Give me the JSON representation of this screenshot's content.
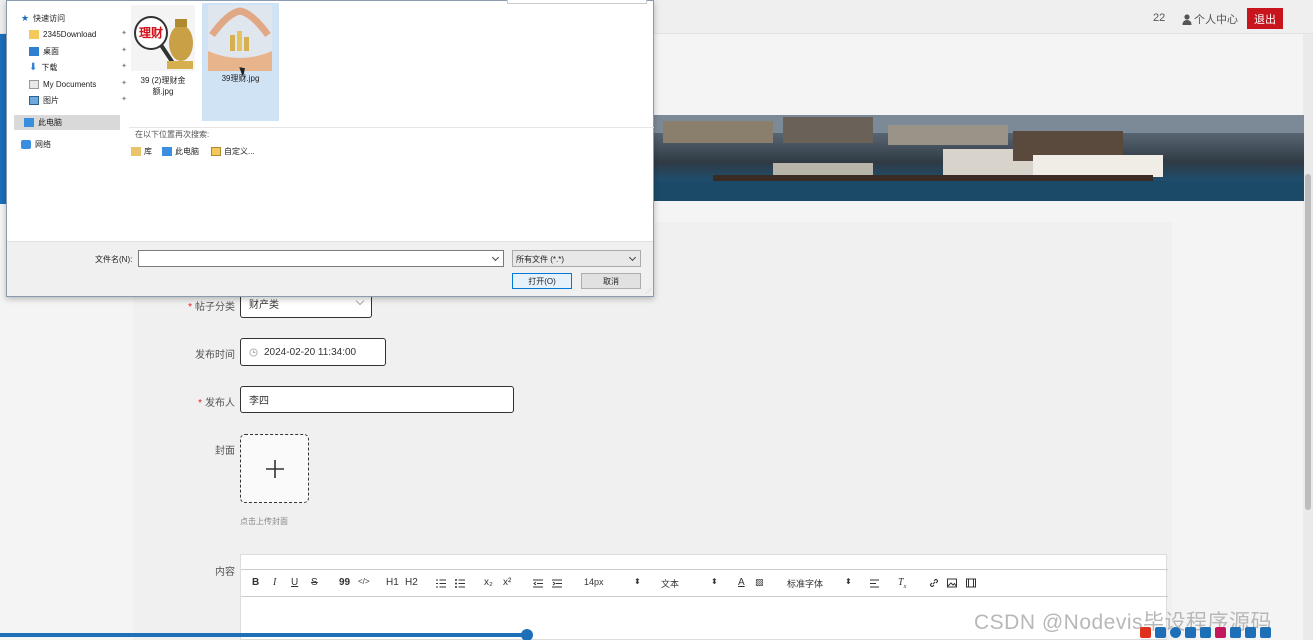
{
  "topnav": {
    "count": "22",
    "profile_label": "个人中心",
    "logout_label": "退出"
  },
  "form": {
    "category": {
      "label": "帖子分类",
      "value": "财产类"
    },
    "publish_time": {
      "label": "发布时间",
      "value": "2024-02-20 11:34:00"
    },
    "publisher": {
      "label": "发布人",
      "value": "李四"
    },
    "cover": {
      "label": "封面",
      "hint": "点击上传封面"
    },
    "content": {
      "label": "内容"
    }
  },
  "editor_toolbar": {
    "bold": "B",
    "italic": "I",
    "underline": "U",
    "strike": "S",
    "quote": "99",
    "code": "</>",
    "h1": "H1",
    "h2": "H2",
    "sub": "x₂",
    "sup": "x²",
    "font_size": "14px",
    "text_type": "文本",
    "font_family": "标准字体"
  },
  "dialog": {
    "nav": [
      {
        "label": "快速访问"
      },
      {
        "label": "2345Download"
      },
      {
        "label": "桌面"
      },
      {
        "label": "下载"
      },
      {
        "label": "My Documents"
      },
      {
        "label": "图片"
      },
      {
        "label": "此电脑"
      },
      {
        "label": "网络"
      }
    ],
    "files": [
      {
        "name_line1": "39 (2)理财金",
        "name_line2": "额.jpg",
        "thumb_text": "理财"
      },
      {
        "name": "39理财.jpg"
      }
    ],
    "search_again": "在以下位置再次搜索:",
    "search_links": [
      "库",
      "此电脑",
      "自定义..."
    ],
    "filename_label": "文件名(N):",
    "filename_value": "",
    "filetype": "所有文件 (*.*)",
    "open_label": "打开(O)",
    "cancel_label": "取消"
  },
  "watermark": "CSDN @Nodevis毕设程序源码",
  "colors": {
    "accent_red": "#c8151d",
    "accent_blue": "#1d6fb8",
    "selection": "#cfe3f5"
  }
}
